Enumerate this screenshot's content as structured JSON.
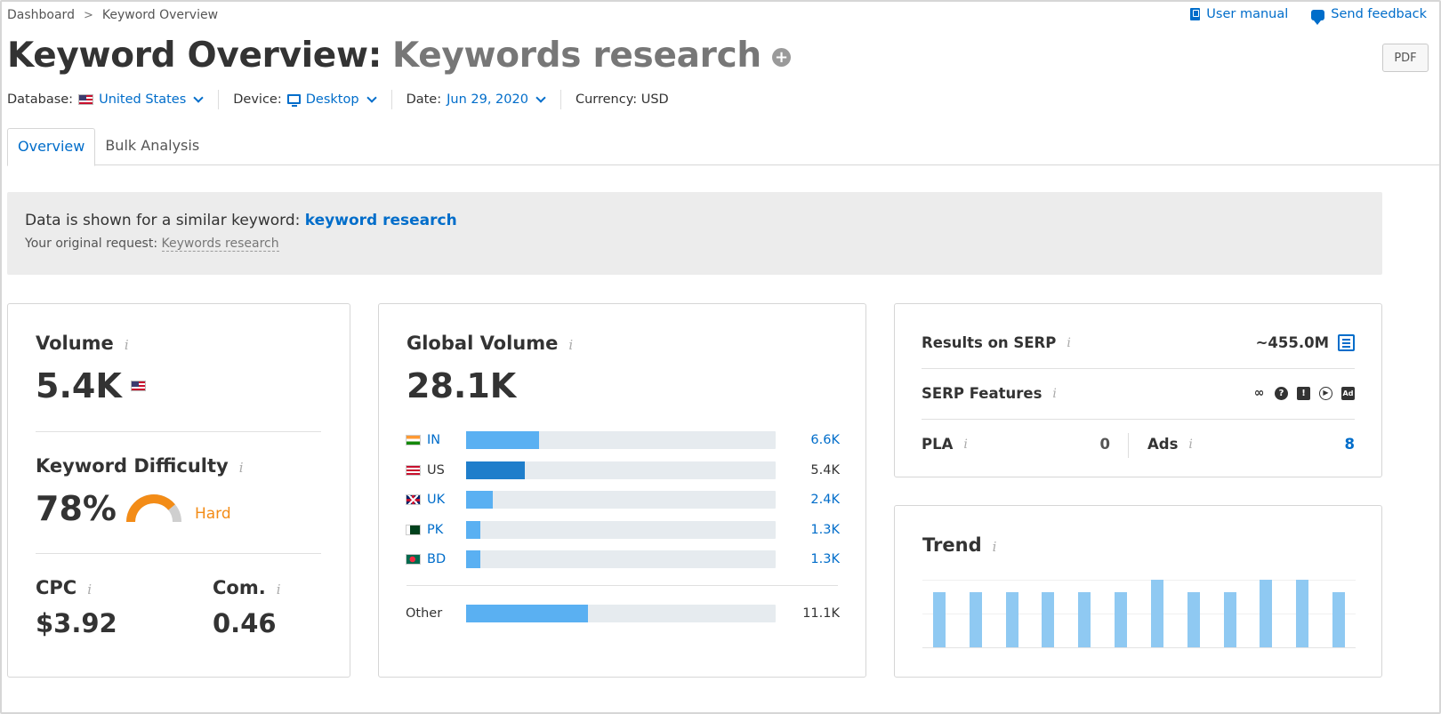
{
  "breadcrumb": {
    "items": [
      "Dashboard",
      "Keyword Overview"
    ],
    "separator": ">"
  },
  "top_links": {
    "user_manual": "User manual",
    "send_feedback": "Send feedback"
  },
  "title": {
    "prefix": "Keyword Overview:",
    "keyword": "Keywords research",
    "plus": "+"
  },
  "pdf_button": "PDF",
  "filters": {
    "database_label": "Database:",
    "database_value": "United States",
    "device_label": "Device:",
    "device_value": "Desktop",
    "date_label": "Date:",
    "date_value": "Jun 29, 2020",
    "currency": "Currency: USD"
  },
  "tabs": [
    {
      "label": "Overview",
      "active": true
    },
    {
      "label": "Bulk Analysis",
      "active": false
    }
  ],
  "notice": {
    "line1_text": "Data is shown for a similar keyword:",
    "line1_link": "keyword research",
    "line2_text": "Your original request:",
    "line2_value": "Keywords research"
  },
  "volume": {
    "label": "Volume",
    "value": "5.4K"
  },
  "difficulty": {
    "label": "Keyword Difficulty",
    "value": "78%",
    "level": "Hard",
    "percent": 78,
    "color": "#f38c17"
  },
  "cpc": {
    "label": "CPC",
    "value": "$3.92"
  },
  "competition": {
    "label": "Com.",
    "value": "0.46"
  },
  "info_glyph": "i",
  "global_volume": {
    "label": "Global Volume",
    "value": "28.1K",
    "countries": [
      {
        "code": "IN",
        "value": "6.6K",
        "fraction": 0.235,
        "link": true
      },
      {
        "code": "US",
        "value": "5.4K",
        "fraction": 0.19,
        "link": false,
        "highlight": true
      },
      {
        "code": "UK",
        "value": "2.4K",
        "fraction": 0.085,
        "link": true
      },
      {
        "code": "PK",
        "value": "1.3K",
        "fraction": 0.046,
        "link": true
      },
      {
        "code": "BD",
        "value": "1.3K",
        "fraction": 0.046,
        "link": true
      }
    ],
    "other": {
      "label": "Other",
      "value": "11.1K",
      "fraction": 0.395
    }
  },
  "serp": {
    "results_label": "Results on SERP",
    "results_value": "~455.0M",
    "features_label": "SERP Features",
    "feature_icons": [
      "link-icon",
      "question-icon",
      "review-icon",
      "video-icon",
      "ad-icon"
    ],
    "pla_label": "PLA",
    "pla_value": "0",
    "ads_label": "Ads",
    "ads_value": "8"
  },
  "trend": {
    "label": "Trend",
    "values": [
      0.82,
      0.82,
      0.82,
      0.82,
      0.82,
      0.82,
      1.0,
      0.82,
      0.82,
      1.0,
      1.0,
      0.82
    ]
  },
  "colors": {
    "link": "#006dca",
    "bar": "#5ab0f2",
    "bar_highlight": "#1f7ecb",
    "trend": "#8fc9f2",
    "hard": "#f38c17"
  }
}
